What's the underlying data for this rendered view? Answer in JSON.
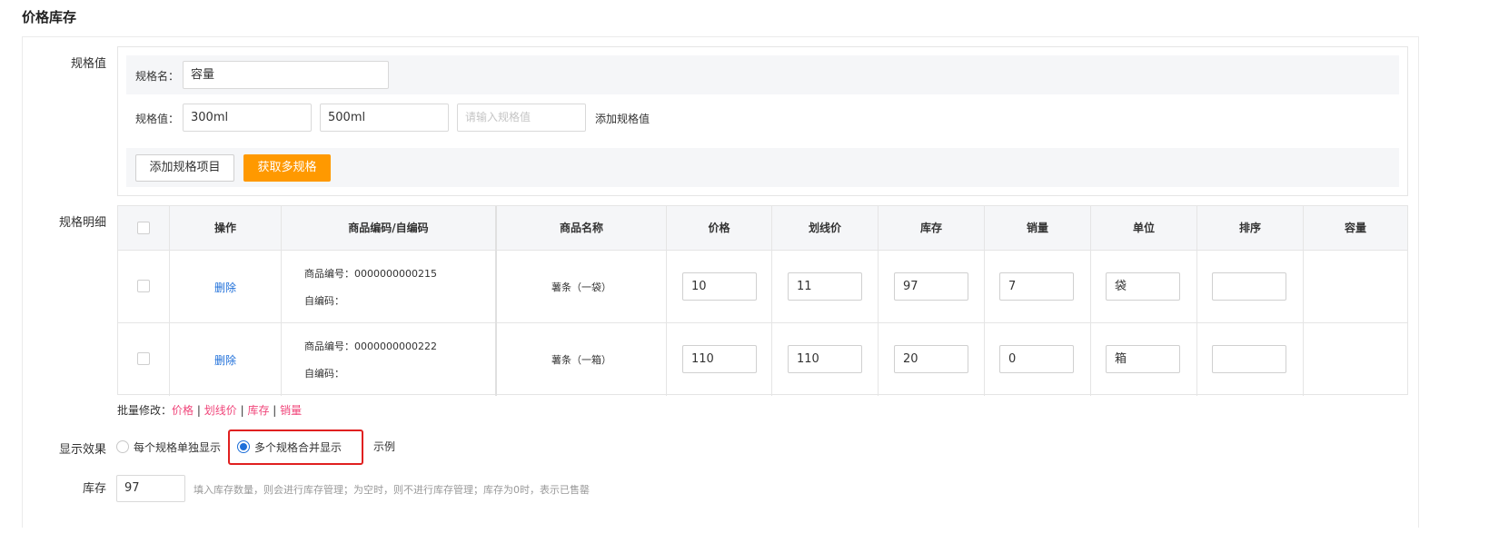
{
  "page_title": "价格库存",
  "spec_value_label": "规格值",
  "spec": {
    "name_label": "规格名：",
    "name_value": "容量",
    "value_label": "规格值：",
    "values": [
      "300ml",
      "500ml"
    ],
    "value_placeholder": "请输入规格值",
    "add_value_link": "添加规格值",
    "add_item_button": "添加规格项目",
    "get_multi_button": "获取多规格"
  },
  "detail_label": "规格明细",
  "table": {
    "headers": {
      "op": "操作",
      "code": "商品编码/自编码",
      "name": "商品名称",
      "price": "价格",
      "strike": "划线价",
      "stock": "库存",
      "sales": "销量",
      "unit": "单位",
      "sort": "排序",
      "capacity": "容量"
    },
    "rows": [
      {
        "op": "删除",
        "code": "商品编号：0000000000215",
        "self_code": "自编码：",
        "name": "薯条（一袋）",
        "price": "10",
        "strike": "11",
        "stock": "97",
        "sales": "7",
        "unit": "袋",
        "sort": ""
      },
      {
        "op": "删除",
        "code": "商品编号：0000000000222",
        "self_code": "自编码：",
        "name": "薯条（一箱）",
        "price": "110",
        "strike": "110",
        "stock": "20",
        "sales": "0",
        "unit": "箱",
        "sort": ""
      }
    ]
  },
  "batch": {
    "label": "批量修改：",
    "items": [
      "价格",
      "划线价",
      "库存",
      "销量"
    ],
    "sep": "|"
  },
  "display": {
    "label": "显示效果",
    "option_separate": "每个规格单独显示",
    "option_merge": "多个规格合并显示",
    "selected": "多个规格合并显示",
    "example_link": "示例"
  },
  "stock": {
    "label": "库存",
    "value": "97",
    "hint": "填入库存数量，则会进行库存管理；为空时，则不进行库存管理；库存为0时，表示已售罄"
  },
  "colors": {
    "accent_blue": "#1e6fd9",
    "orange_button": "#ff9900",
    "batch_link_pink": "#f0457a",
    "highlight_red": "#e02020"
  }
}
